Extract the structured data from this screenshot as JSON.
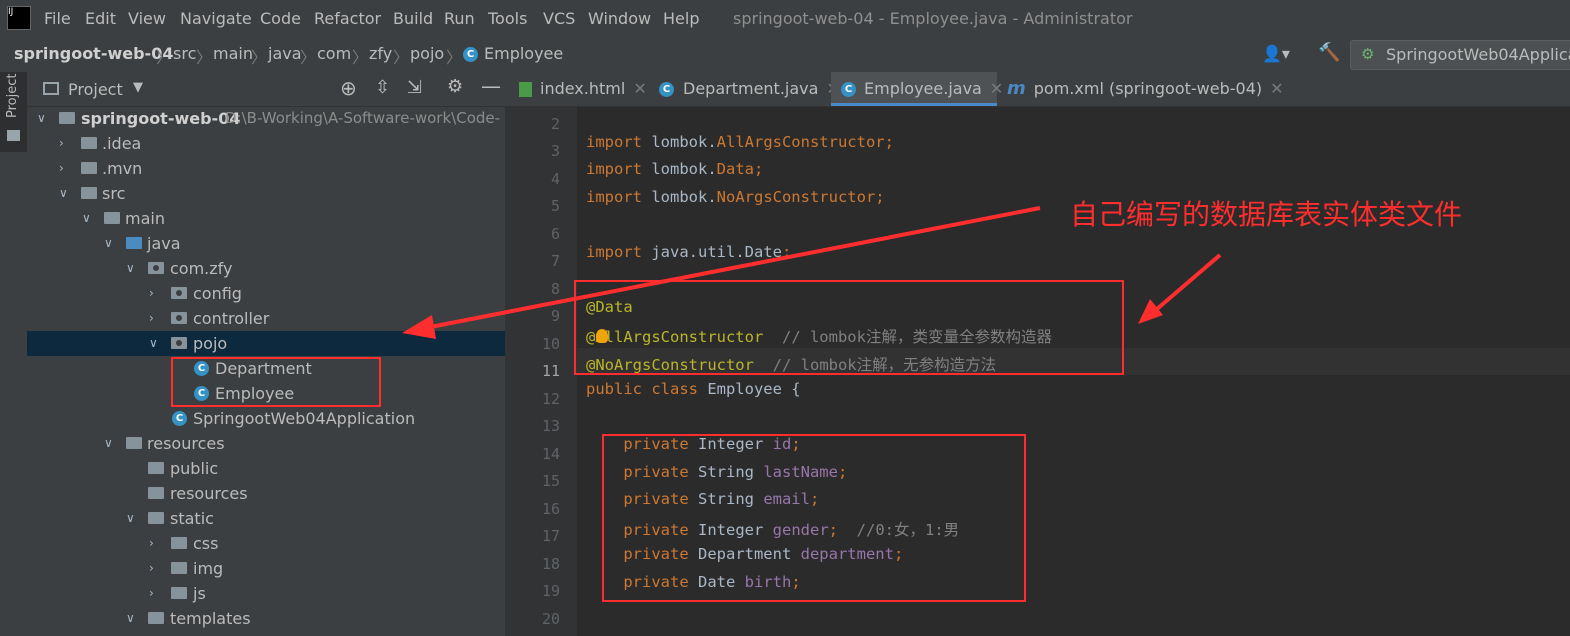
{
  "menubar": {
    "items": [
      "File",
      "Edit",
      "View",
      "Navigate",
      "Code",
      "Refactor",
      "Build",
      "Run",
      "Tools",
      "VCS",
      "Window",
      "Help"
    ],
    "window_title": "springoot-web-04 - Employee.java - Administrator"
  },
  "breadcrumb": [
    "springoot-web-04",
    "src",
    "main",
    "java",
    "com",
    "zfy",
    "pojo",
    "Employee"
  ],
  "run_config": "SpringootWeb04Applica",
  "sidestrip": {
    "label": "Project"
  },
  "project_panel": {
    "title": "Project",
    "tree": [
      {
        "label": "springoot-web-04",
        "path": "D:\\B-Working\\A-Software-work\\Code-"
      },
      {
        "label": ".idea"
      },
      {
        "label": ".mvn"
      },
      {
        "label": "src"
      },
      {
        "label": "main"
      },
      {
        "label": "java"
      },
      {
        "label": "com.zfy"
      },
      {
        "label": "config"
      },
      {
        "label": "controller"
      },
      {
        "label": "pojo"
      },
      {
        "label": "Department"
      },
      {
        "label": "Employee"
      },
      {
        "label": "SpringootWeb04Application"
      },
      {
        "label": "resources"
      },
      {
        "label": "public"
      },
      {
        "label": "resources"
      },
      {
        "label": "static"
      },
      {
        "label": "css"
      },
      {
        "label": "img"
      },
      {
        "label": "js"
      },
      {
        "label": "templates"
      }
    ]
  },
  "tabs": [
    {
      "label": "index.html"
    },
    {
      "label": "Department.java"
    },
    {
      "label": "Employee.java"
    },
    {
      "label": "pom.xml (springoot-web-04)"
    }
  ],
  "editor": {
    "line_numbers": [
      "2",
      "3",
      "4",
      "5",
      "6",
      "7",
      "8",
      "9",
      "10",
      "11",
      "12",
      "13",
      "14",
      "15",
      "16",
      "17",
      "18",
      "19",
      "20"
    ],
    "current_line": "11"
  },
  "annotation": {
    "text": "自己编写的数据库表实体类文件",
    "color": "#ff2e2e"
  },
  "colors": {
    "keyword": "#cc7832",
    "annotation": "#bbb529",
    "comment": "#808080",
    "field": "#9876aa",
    "accent": "#4a88c7"
  }
}
